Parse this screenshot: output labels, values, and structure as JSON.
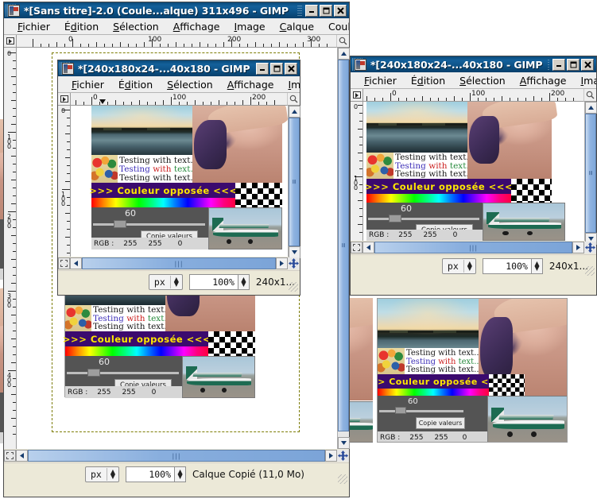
{
  "main_window": {
    "title": "*[Sans titre]-2.0 (Coule...alque) 311x496 - GIMP",
    "icon": "gimp-wilber-icon",
    "buttons": {
      "minimize": "minimize-icon",
      "maximize": "maximize-icon",
      "close": "close-icon"
    },
    "menu": [
      {
        "label": "Fichier",
        "mnemonic": "F"
      },
      {
        "label": "Édition",
        "mnemonic": "d"
      },
      {
        "label": "Sélection",
        "mnemonic": "S"
      },
      {
        "label": "Affichage",
        "mnemonic": "A"
      },
      {
        "label": "Image",
        "mnemonic": "I"
      },
      {
        "label": "Calque",
        "mnemonic": "C"
      },
      {
        "label": "Couleurs",
        "mnemonic": "r"
      }
    ],
    "ruler_h_labels": [
      "0",
      "100",
      "200",
      "300"
    ],
    "ruler_v_labels": [
      "0",
      "100",
      "200",
      "300",
      "400"
    ],
    "statusbar": {
      "unit": "px",
      "zoom": "100%",
      "message": "Calque Copié (11,0 Mo)"
    }
  },
  "inner_window": {
    "title": "*[240x180x24-...40x180 - GIMP",
    "icon": "gimp-wilber-icon",
    "buttons": {
      "minimize": "minimize-icon",
      "maximize": "maximize-icon",
      "close": "close-icon"
    },
    "menu": [
      {
        "label": "Fichier",
        "mnemonic": "F"
      },
      {
        "label": "Édition",
        "mnemonic": "d"
      },
      {
        "label": "Sélection",
        "mnemonic": "S"
      },
      {
        "label": "Affichage",
        "mnemonic": "A"
      },
      {
        "label": "Image",
        "mnemonic": "I"
      }
    ],
    "ruler_h_labels": [
      "0",
      "100",
      "200"
    ],
    "ruler_v_labels": [
      "0",
      "100"
    ],
    "statusbar": {
      "unit": "px",
      "zoom": "100%",
      "message": "240x1..."
    }
  },
  "right_window": {
    "title": "*[240x180x24-...40x180 - GIMP",
    "icon": "gimp-wilber-icon",
    "buttons": {
      "minimize": "minimize-icon",
      "maximize": "maximize-icon",
      "close": "close-icon"
    },
    "menu": [
      {
        "label": "Fichier",
        "mnemonic": "F"
      },
      {
        "label": "Édition",
        "mnemonic": "d"
      },
      {
        "label": "Sélection",
        "mnemonic": "S"
      },
      {
        "label": "Affichage",
        "mnemonic": "A"
      },
      {
        "label": "Image",
        "mnemonic": "I"
      }
    ],
    "ruler_h_labels": [
      "0",
      "100",
      "200"
    ],
    "ruler_v_labels": [
      "0",
      "100"
    ],
    "statusbar": {
      "unit": "px",
      "zoom": "100%",
      "message": "240x1..."
    }
  },
  "artwork": {
    "text_lines": [
      {
        "segments": [
          {
            "text": "Testing with text...",
            "color": "#1a1a1a"
          }
        ]
      },
      {
        "segments": [
          {
            "text": "Testing ",
            "color": "#3d2fb8"
          },
          {
            "text": "with ",
            "color": "#cc2020"
          },
          {
            "text": "text...",
            "color": "#2a8c3f"
          }
        ]
      },
      {
        "segments": [
          {
            "text": "Testing with text...",
            "color": "#1a1a1a"
          }
        ]
      }
    ],
    "band_text": ">>> Couleur opposée <<<",
    "band_bg": "#3b0a6e",
    "band_fg": "#ffe800",
    "slider_value": "60",
    "copy_button": "Copie valeurs",
    "rgb_label": "RGB :",
    "rgb_values": [
      "255",
      "255",
      "0"
    ],
    "photo_lake": "lake-sunset-photo",
    "photo_portrait": "lena-portrait-photo",
    "photo_balls": "colored-balls-photo",
    "photo_plane": "green-airplane-photo",
    "checker": "transparency-checkerboard"
  },
  "scrollbars": {
    "grip_glyph": "‖",
    "left_arrow": "◀",
    "right_arrow": "▶",
    "up_arrow": "▲",
    "down_arrow": "▼"
  },
  "colors": {
    "title_active": "#0d5287",
    "title_inactive": "#6f7f8f",
    "window_face": "#ece9d8",
    "scroll_thumb": "#88aede",
    "selection_ants": "#d8d800"
  }
}
